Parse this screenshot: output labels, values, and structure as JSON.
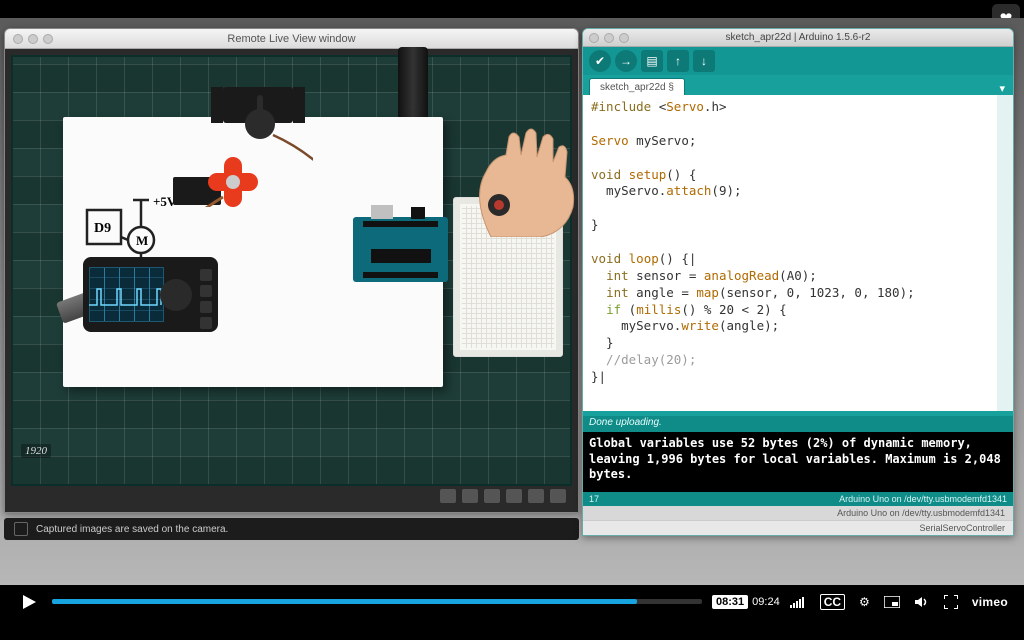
{
  "left_window": {
    "title": "Remote Live View window",
    "resolution_badge": "1920",
    "status_text": "Captured images are saved on the camera.",
    "diagram": {
      "pin": "D9",
      "motor": "M",
      "voltage": "+5V"
    }
  },
  "ide": {
    "window_title": "sketch_apr22d | Arduino 1.5.6-r2",
    "tab_name": "sketch_apr22d §",
    "code": {
      "l1a": "#include",
      "l1b": "<",
      "l1c": "Servo",
      "l1d": ".h>",
      "l3a": "Servo",
      "l3b": " myServo;",
      "l5a": "void",
      "l5b": "setup",
      "l5c": "() {",
      "l6a": "  myServo.",
      "l6b": "attach",
      "l6c": "(9);",
      "l8": "}",
      "l10a": "void",
      "l10b": "loop",
      "l10c": "() {|",
      "l11a": "int",
      "l11b": " sensor = ",
      "l11c": "analogRead",
      "l11d": "(A0);",
      "l12a": "int",
      "l12b": " angle = ",
      "l12c": "map",
      "l12d": "(sensor, 0, 1023, 0, 180);",
      "l13a": "if",
      "l13b": " (",
      "l13c": "millis",
      "l13d": "() % 20 < 2) {",
      "l14a": "    myServo.",
      "l14b": "write",
      "l14c": "(angle);",
      "l15": "  }",
      "l16": "  //delay(20);",
      "l17": "}|"
    },
    "status_line": "Done uploading.",
    "console": "Global variables use 52 bytes (2%) of dynamic memory, leaving 1,996 bytes for local variables. Maximum is 2,048 bytes.",
    "footer_left": "17",
    "footer_right": "Arduino Uno on /dev/tty.usbmodemfd1341",
    "mac_footer1": "Arduino Uno on /dev/tty.usbmodemfd1341",
    "mac_footer2": "SerialServoController"
  },
  "player": {
    "current_time": "08:31",
    "total_time": "09:24",
    "progress_pct": 90,
    "cc_label": "CC",
    "brand": "vimeo"
  }
}
